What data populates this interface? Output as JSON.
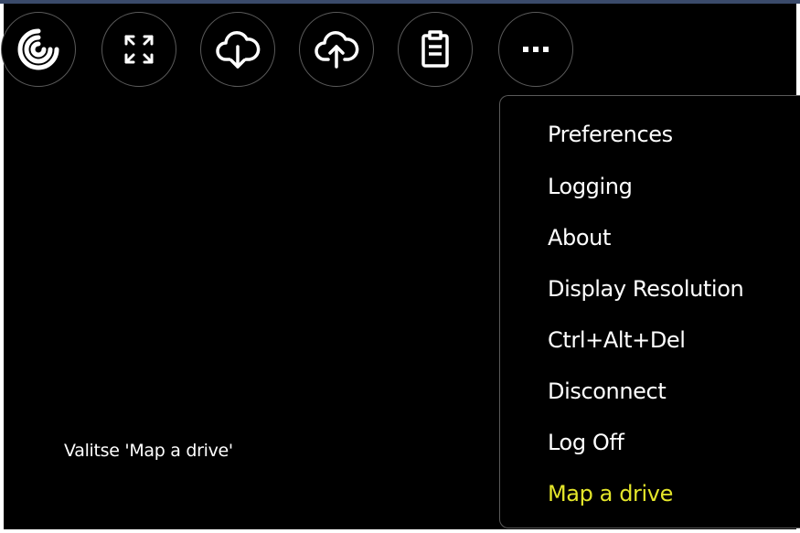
{
  "toolbar": {
    "buttons": [
      {
        "icon": "citrix-logo-icon"
      },
      {
        "icon": "fullscreen-icon"
      },
      {
        "icon": "cloud-download-icon"
      },
      {
        "icon": "cloud-upload-icon"
      },
      {
        "icon": "clipboard-icon"
      },
      {
        "icon": "more-options-icon"
      }
    ]
  },
  "menu": {
    "items": [
      {
        "label": "Preferences"
      },
      {
        "label": "Logging"
      },
      {
        "label": "About"
      },
      {
        "label": "Display Resolution"
      },
      {
        "label": "Ctrl+Alt+Del"
      },
      {
        "label": "Disconnect"
      },
      {
        "label": "Log Off"
      },
      {
        "label": "Map a drive"
      }
    ],
    "highlight_color": "#e4e62a"
  },
  "instruction": {
    "text": "Valitse 'Map a drive'"
  },
  "colors": {
    "background": "#000000",
    "text": "#ffffff",
    "border": "#5a5a5a"
  }
}
